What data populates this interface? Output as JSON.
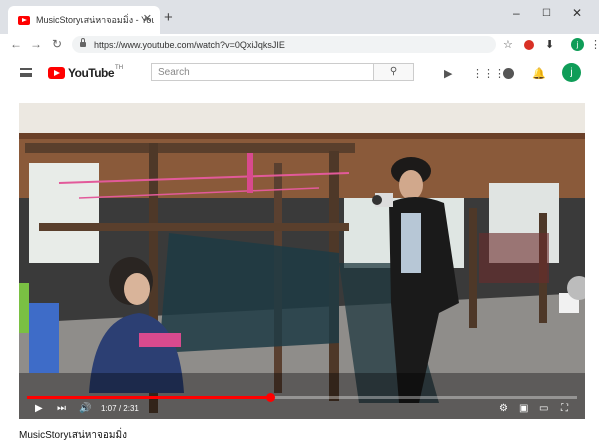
{
  "browser": {
    "tab_title": "MusicStoryเสน่หาจอมมิ่ง - YouTube",
    "url": "https://www.youtube.com/watch?v=0QxiJqksJIE",
    "profile_initial": "j"
  },
  "youtube": {
    "logo_text": "YouTube",
    "logo_sup": "TH",
    "search_placeholder": "Search",
    "avatar_initial": "j"
  },
  "player": {
    "current_time": "1:07",
    "duration": "2:31",
    "progress": 0.443
  },
  "video": {
    "title": "MusicStoryเสน่หาจอมมิ่ง"
  },
  "colors": {
    "brand_red": "#ff0000",
    "avatar_green": "#0f9d58"
  }
}
